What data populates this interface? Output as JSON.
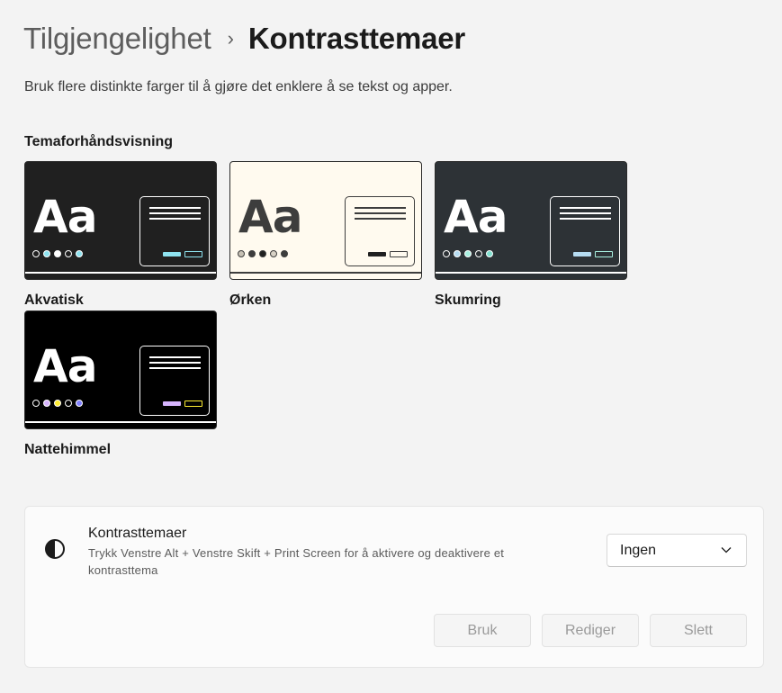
{
  "breadcrumb": {
    "parent": "Tilgjengelighet",
    "current": "Kontrasttemaer"
  },
  "subtitle": "Bruk flere distinkte farger til å gjøre det enklere å se tekst og apper.",
  "preview_section": {
    "title": "Temaforhåndsvisning"
  },
  "themes": [
    {
      "name": "Akvatisk",
      "sample": "Aa",
      "colors": {
        "bg": "#202020",
        "text": "#ffffff",
        "border": "#ffffff",
        "line": "#ffffff",
        "dots": [
          "#202020",
          "#8ee3f0",
          "#ffffff",
          "#202020",
          "#8ee3f0"
        ],
        "btn_fill": "#8ee3f0",
        "btn_outline": "#8ee3f0"
      }
    },
    {
      "name": "Ørken",
      "sample": "Aa",
      "colors": {
        "bg": "#fffaef",
        "text": "#3d3d3d",
        "border": "#3d3d3d",
        "line": "#3d3d3d",
        "dots": [
          "#c6c0b4",
          "#3d3d3d",
          "#202020",
          "#d8d2c6",
          "#3d3d3d"
        ],
        "btn_fill": "#202020",
        "btn_outline": "#3d3d3d"
      }
    },
    {
      "name": "Skumring",
      "sample": "Aa",
      "colors": {
        "bg": "#2d3236",
        "text": "#ffffff",
        "border": "#ffffff",
        "line": "#ffffff",
        "dots": [
          "#2d3236",
          "#b6dcf2",
          "#a8f0e0",
          "#2d3236",
          "#80e0d0"
        ],
        "btn_fill": "#b6dcf2",
        "btn_outline": "#a8f0e0"
      }
    },
    {
      "name": "Nattehimmel",
      "sample": "Aa",
      "colors": {
        "bg": "#000000",
        "text": "#ffffff",
        "border": "#ffffff",
        "line": "#ffffff",
        "dots": [
          "#000000",
          "#d6b4fd",
          "#ffee32",
          "#000000",
          "#8080ff"
        ],
        "btn_fill": "#d6b4fd",
        "btn_outline": "#ffee32"
      }
    }
  ],
  "contrast_setting": {
    "icon": "contrast-icon",
    "title": "Kontrasttemaer",
    "description": "Trykk Venstre Alt + Venstre Skift + Print Screen for å aktivere og deaktivere et kontrasttema",
    "selected": "Ingen",
    "buttons": {
      "apply": "Bruk",
      "edit": "Rediger",
      "delete": "Slett"
    }
  }
}
